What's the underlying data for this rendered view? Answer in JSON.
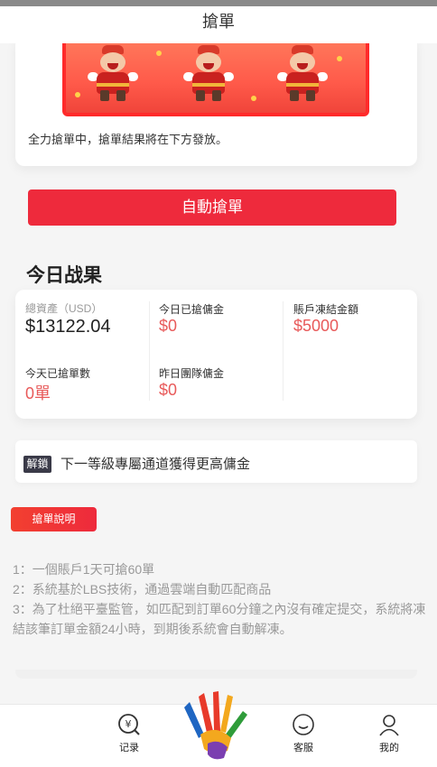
{
  "header": {
    "title": "搶單"
  },
  "banner": {
    "text": "全力搶單中，搶單結果將在下方發放。"
  },
  "grab_button": {
    "label": "自動搶單"
  },
  "stats": {
    "title": "今日战果",
    "items": [
      {
        "label": "總資產（USD）",
        "value": "$13122.04"
      },
      {
        "label": "今日已搶傭金",
        "value": "$0"
      },
      {
        "label": "賬戶凍結金額",
        "value": "$5000"
      },
      {
        "label": "今天已搶單數",
        "value": "0單"
      },
      {
        "label": "昨日團隊傭金",
        "value": "$0"
      }
    ]
  },
  "notice": {
    "badge": "解鎖",
    "text": "下一等級專屬通道獲得更高傭金"
  },
  "explain": {
    "button_label": "搶單說明",
    "rules": [
      "1：一個賬戶1天可搶60單",
      "2：系統基於LBS技術，通過雲端自動匹配商品",
      "3：為了杜絕平臺監管，如匹配到訂單60分鐘之內沒有確定提交，系統將凍結該筆訂單金額24小時，到期後系統會自動解凍。"
    ]
  },
  "tabbar": {
    "items": [
      {
        "label": "记录",
        "icon": "yuan-search-icon"
      },
      {
        "label": "",
        "icon": "hand-logo-icon"
      },
      {
        "label": "客服",
        "icon": "chat-icon"
      },
      {
        "label": "我的",
        "icon": "user-icon"
      }
    ]
  },
  "colors": {
    "accent": "#ee2a3c",
    "value_red": "#e85a5a",
    "badge_dark": "#3a3a48"
  }
}
